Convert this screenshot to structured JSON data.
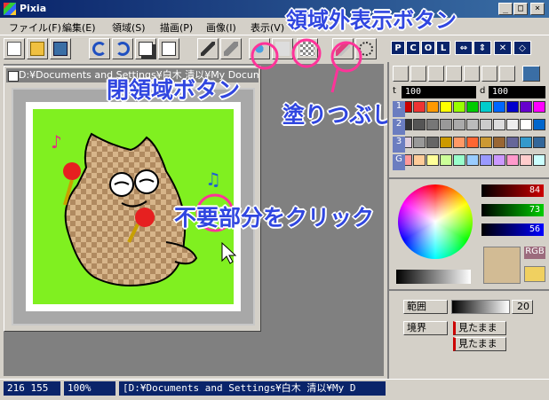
{
  "app": {
    "title": "Pixia"
  },
  "menu": [
    "ファイル(F)",
    "編集(E)",
    "領域(S)",
    "描画(P)",
    "画像(I)",
    "表示(V)"
  ],
  "palette_tabs": [
    "P",
    "C",
    "O",
    "L"
  ],
  "document": {
    "title": "D:¥Documents and Settings¥白木 清以¥My Documents¥..."
  },
  "layer_values": {
    "t": "100",
    "d": "100"
  },
  "palette_rows": [
    "1",
    "2",
    "3",
    "G"
  ],
  "color_values": {
    "r": "84",
    "g": "73",
    "b": "56"
  },
  "rgb_label": "RGB",
  "range": {
    "label": "範囲",
    "value": "20"
  },
  "border": {
    "label": "境界",
    "option1": "見たまま",
    "option2": "見たまま"
  },
  "status": {
    "coords": "216 155",
    "zoom": "100%",
    "path": "[D:¥Documents and Settings¥白木 清以¥My D"
  },
  "annotations": {
    "outside_display": "領域外表示ボタン",
    "closed_area": "閉領域ボタン",
    "fill_button": "塗りつぶしボタン",
    "click_unwanted": "不要部分をクリック"
  },
  "colors": {
    "accent_annotation": "#3046e0",
    "circle": "#ff3399",
    "canvas_bg": "#80f020",
    "selected_color": "#d2bb94"
  }
}
